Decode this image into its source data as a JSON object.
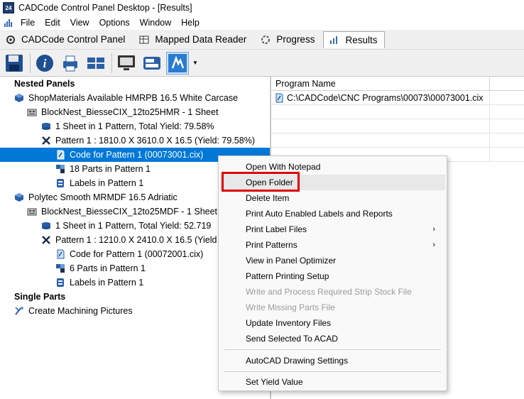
{
  "window": {
    "title": "CADCode Control Panel Desktop - [Results]",
    "app_icon_text": "24"
  },
  "menu": [
    "File",
    "Edit",
    "View",
    "Options",
    "Window",
    "Help"
  ],
  "tabs": [
    {
      "label": "CADCode Control Panel",
      "icon": "gear-icon"
    },
    {
      "label": "Mapped Data Reader",
      "icon": "table-icon"
    },
    {
      "label": "Progress",
      "icon": "spinner-icon"
    },
    {
      "label": "Results",
      "icon": "chart-icon",
      "active": true
    }
  ],
  "toolbar": {
    "buttons": [
      "save-icon",
      "info-icon",
      "print-icon",
      "panels-icon",
      "monitor-icon",
      "labels-icon",
      "cad-icon"
    ]
  },
  "tree": {
    "nested_panels": "Nested Panels",
    "item1": "ShopMaterials Available HMRPB 16.5 White Carcase",
    "item1_nest": "BlockNest_BiesseCIX_12to25HMR - 1 Sheet",
    "item1_sheet": "1 Sheet in 1 Pattern,  Total Yield: 79.58%",
    "item1_pattern": "Pattern 1 : 1810.0 X 3610.0 X 16.5  (Yield: 79.58%)",
    "item1_code": "Code for Pattern 1 (00073001.cix)",
    "item1_parts": "18 Parts in Pattern 1",
    "item1_labels": "Labels in Pattern 1",
    "item2": "Polytec Smooth MRMDF 16.5 Adriatic",
    "item2_nest": "BlockNest_BiesseCIX_12to25MDF - 1 Sheet",
    "item2_sheet": "1 Sheet in 1 Pattern,  Total Yield: 52.719",
    "item2_pattern": "Pattern 1 : 1210.0 X 2410.0 X 16.5  (Yield",
    "item2_code": "Code for Pattern 1 (00072001.cix)",
    "item2_parts": "6 Parts in Pattern 1",
    "item2_labels": "Labels in Pattern 1",
    "single_parts": "Single Parts",
    "machining": "Create Machining Pictures"
  },
  "grid": {
    "header": "Program Name",
    "rows": [
      "C:\\CADCode\\CNC Programs\\00073\\00073001.cix"
    ]
  },
  "context_menu": {
    "open_notepad": "Open With Notepad",
    "open_folder": "Open Folder",
    "delete_item": "Delete Item",
    "print_auto": "Print Auto Enabled Labels and Reports",
    "print_label_files": "Print Label Files",
    "print_patterns": "Print Patterns",
    "view_optimizer": "View in Panel Optimizer",
    "pattern_setup": "Pattern Printing Setup",
    "write_strip": "Write and Process Required Strip Stock File",
    "write_missing": "Write Missing Parts File",
    "update_inventory": "Update Inventory Files",
    "send_acad": "Send Selected To ACAD",
    "autocad_settings": "AutoCAD Drawing Settings",
    "set_yield": "Set Yield Value",
    "submenu_arrow": "›"
  },
  "colors": {
    "selection": "#0078d7",
    "highlight": "#e00000",
    "accent": "#3a6db0"
  }
}
